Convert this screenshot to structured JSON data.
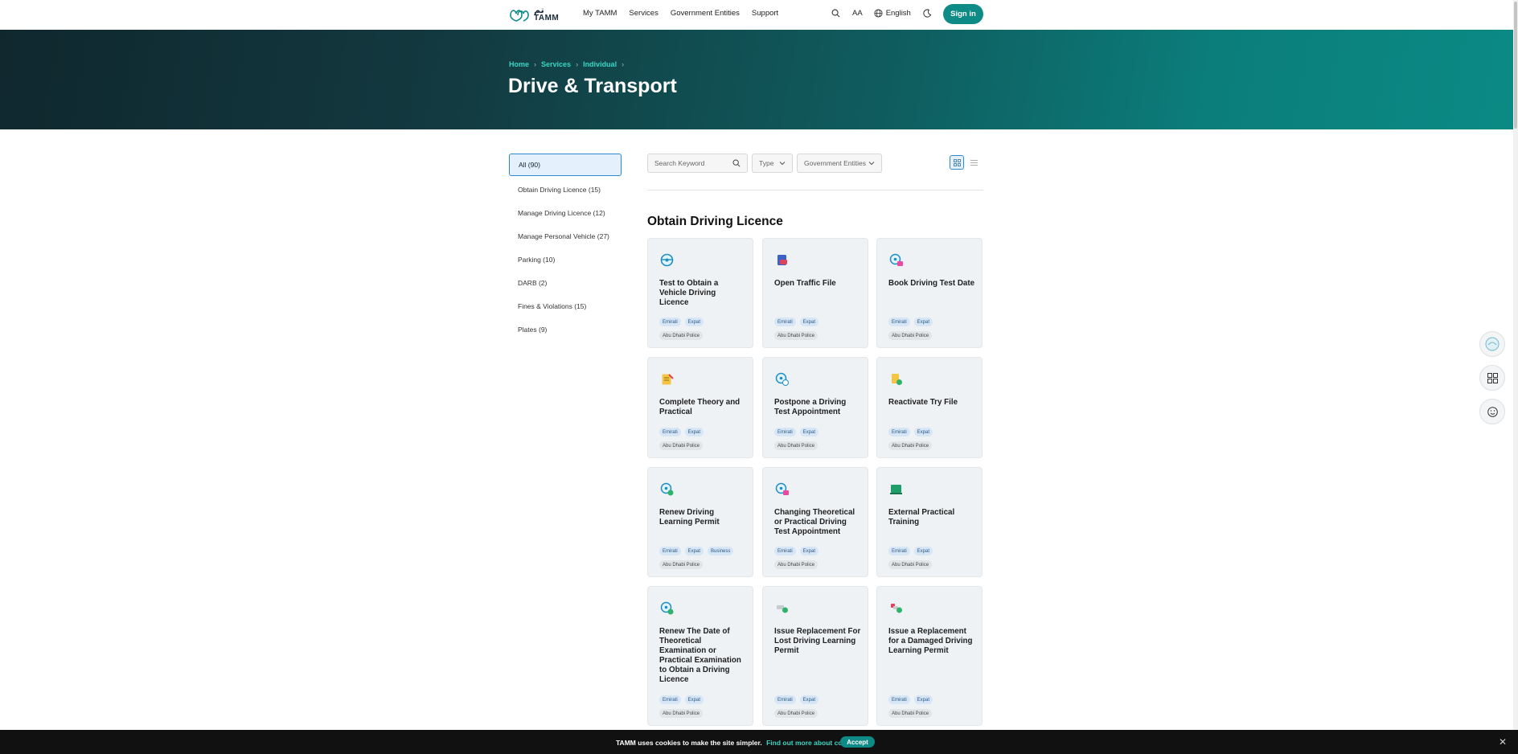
{
  "header": {
    "logo_arabic": "تم",
    "logo_text": "TAMM",
    "nav": [
      "My TAMM",
      "Services",
      "Government Entities",
      "Support"
    ],
    "text_size_label": "AA",
    "language": "English",
    "signin": "Sign in",
    "brand_color": "#0e8b86"
  },
  "hero": {
    "breadcrumb": [
      "Home",
      "Services",
      "Individual"
    ],
    "title": "Drive & Transport"
  },
  "sidebar": {
    "items": [
      {
        "label": "All (90)",
        "active": true
      },
      {
        "label": "Obtain Driving Licence (15)"
      },
      {
        "label": "Manage Driving Licence (12)"
      },
      {
        "label": "Manage Personal Vehicle (27)"
      },
      {
        "label": "Parking (10)"
      },
      {
        "label": "DARB (2)"
      },
      {
        "label": "Fines & Violations (15)"
      },
      {
        "label": "Plates (9)"
      }
    ]
  },
  "filters": {
    "search_placeholder": "Search Keyword",
    "type": "Type",
    "entities": "Government Entities"
  },
  "section": {
    "title": "Obtain Driving Licence"
  },
  "cards": [
    {
      "title": "Test to Obtain a Vehicle Driving Licence",
      "icon": "steering-wheel-icon",
      "tags": [
        "Emirati",
        "Expat"
      ],
      "entity": "Abu Dhabi Police"
    },
    {
      "title": "Open Traffic File",
      "icon": "car-file-icon",
      "tags": [
        "Emirati",
        "Expat"
      ],
      "entity": "Abu Dhabi Police"
    },
    {
      "title": "Book Driving Test Date",
      "icon": "steering-calendar-icon",
      "tags": [
        "Emirati",
        "Expat"
      ],
      "entity": "Abu Dhabi Police"
    },
    {
      "title": "Complete Theory and Practical",
      "icon": "notepad-icon",
      "tags": [
        "Emirati",
        "Expat"
      ],
      "entity": "Abu Dhabi Police"
    },
    {
      "title": "Postpone a Driving Test Appointment",
      "icon": "steering-clock-icon",
      "tags": [
        "Emirati",
        "Expat"
      ],
      "entity": "Abu Dhabi Police"
    },
    {
      "title": "Reactivate Try File",
      "icon": "document-refresh-icon",
      "tags": [
        "Emirati",
        "Expat"
      ],
      "entity": "Abu Dhabi Police"
    },
    {
      "title": "Renew Driving Learning Permit",
      "icon": "steering-renew-icon",
      "tags": [
        "Emirati",
        "Expat",
        "Business"
      ],
      "entity": "Abu Dhabi Police"
    },
    {
      "title": "Changing Theoretical or Practical Driving Test Appointment",
      "icon": "steering-calendar-icon",
      "tags": [
        "Emirati",
        "Expat"
      ],
      "entity": "Abu Dhabi Police"
    },
    {
      "title": "External Practical Training",
      "icon": "training-board-icon",
      "tags": [
        "Emirati",
        "Expat"
      ],
      "entity": "Abu Dhabi Police"
    },
    {
      "title": "Renew The Date of Theoretical Examination or Practical Examination to Obtain a Driving Licence",
      "icon": "steering-renew-icon",
      "tags": [
        "Emirati",
        "Expat"
      ],
      "entity": "Abu Dhabi Police"
    },
    {
      "title": "Issue Replacement For Lost Driving Learning Permit",
      "icon": "permit-check-icon",
      "tags": [
        "Emirati",
        "Expat"
      ],
      "entity": "Abu Dhabi Police"
    },
    {
      "title": "Issue a Replacement for a Damaged Driving Learning Permit",
      "icon": "permit-damaged-icon",
      "tags": [
        "Emirati",
        "Expat"
      ],
      "entity": "Abu Dhabi Police"
    }
  ],
  "cookie": {
    "message": "TAMM uses cookies to make the site simpler.",
    "link": "Find out more about cookies.",
    "accept": "Accept"
  }
}
